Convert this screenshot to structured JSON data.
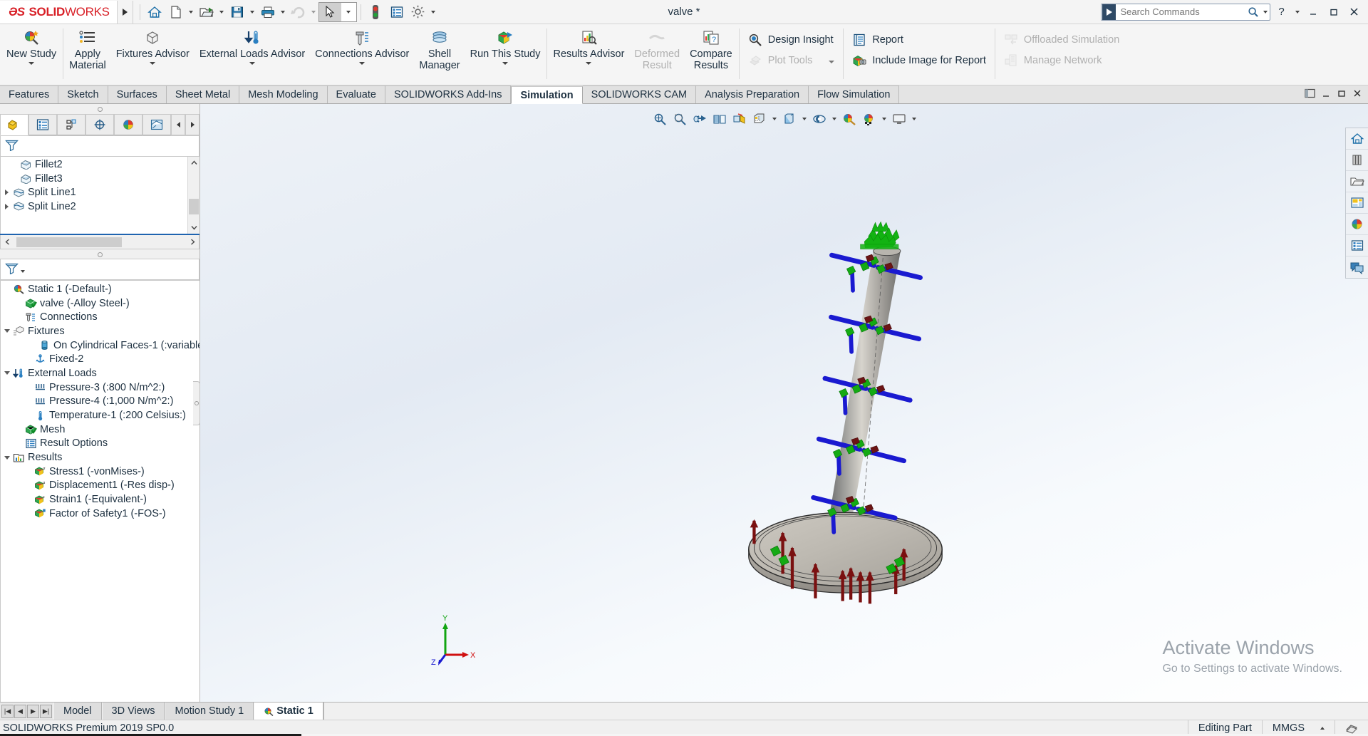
{
  "window": {
    "document_title": "valve *",
    "minimize": "–",
    "maximize": "▭",
    "close": "✕",
    "help": "?",
    "help_caret": "▾"
  },
  "search": {
    "placeholder": "Search Commands",
    "value": ""
  },
  "quick_access": {
    "items": [
      {
        "name": "home-icon",
        "label": "Home"
      },
      {
        "name": "new-document-icon",
        "label": "New"
      },
      {
        "name": "open-folder-icon",
        "label": "Open"
      },
      {
        "name": "save-icon",
        "label": "Save"
      },
      {
        "name": "print-icon",
        "label": "Print"
      },
      {
        "name": "undo-icon",
        "label": "Undo"
      },
      {
        "name": "select-cursor-icon",
        "label": "Select"
      },
      {
        "name": "rebuild-icon",
        "label": "Rebuild"
      },
      {
        "name": "file-properties-icon",
        "label": "File Properties"
      },
      {
        "name": "options-gear-icon",
        "label": "Options"
      }
    ]
  },
  "ribbon": {
    "groups": [
      {
        "name": "study-group",
        "items": [
          {
            "label": "New Study",
            "icon": "new-study-icon",
            "dropdown": true,
            "disabled": false
          }
        ]
      },
      {
        "name": "setup-group",
        "items": [
          {
            "label": "Apply\nMaterial",
            "icon": "apply-material-icon",
            "dropdown": false,
            "disabled": false
          },
          {
            "label": "Fixtures Advisor",
            "icon": "fixtures-advisor-icon",
            "dropdown": true,
            "disabled": false
          },
          {
            "label": "External Loads Advisor",
            "icon": "external-loads-icon",
            "dropdown": true,
            "disabled": false
          },
          {
            "label": "Connections Advisor",
            "icon": "connections-advisor-icon",
            "dropdown": true,
            "disabled": false
          },
          {
            "label": "Shell\nManager",
            "icon": "shell-manager-icon",
            "dropdown": false,
            "disabled": false
          },
          {
            "label": "Run This Study",
            "icon": "run-study-icon",
            "dropdown": true,
            "disabled": false
          }
        ]
      },
      {
        "name": "results-group",
        "items": [
          {
            "label": "Results Advisor",
            "icon": "results-advisor-icon",
            "dropdown": true,
            "disabled": false
          },
          {
            "label": "Deformed\nResult",
            "icon": "deformed-result-icon",
            "dropdown": false,
            "disabled": true
          },
          {
            "label": "Compare\nResults",
            "icon": "compare-results-icon",
            "dropdown": false,
            "disabled": false
          }
        ]
      }
    ],
    "stacks": [
      {
        "name": "insight-stack",
        "rows": [
          {
            "label": "Design Insight",
            "icon": "design-insight-icon",
            "disabled": false,
            "caret": false
          },
          {
            "label": "Plot Tools",
            "icon": "plot-tools-icon",
            "disabled": true,
            "caret": true
          }
        ]
      },
      {
        "name": "report-stack",
        "rows": [
          {
            "label": "Report",
            "icon": "report-icon",
            "disabled": false,
            "caret": false
          },
          {
            "label": "Include Image for Report",
            "icon": "include-image-icon",
            "disabled": false,
            "caret": false
          }
        ]
      },
      {
        "name": "network-stack",
        "rows": [
          {
            "label": "Offloaded Simulation",
            "icon": "offloaded-simulation-icon",
            "disabled": true,
            "caret": false
          },
          {
            "label": "Manage Network",
            "icon": "manage-network-icon",
            "disabled": true,
            "caret": false
          }
        ]
      }
    ]
  },
  "command_tabs": [
    {
      "label": "Features",
      "active": false
    },
    {
      "label": "Sketch",
      "active": false
    },
    {
      "label": "Surfaces",
      "active": false
    },
    {
      "label": "Sheet Metal",
      "active": false
    },
    {
      "label": "Mesh Modeling",
      "active": false
    },
    {
      "label": "Evaluate",
      "active": false
    },
    {
      "label": "SOLIDWORKS Add-Ins",
      "active": false
    },
    {
      "label": "Simulation",
      "active": true
    },
    {
      "label": "SOLIDWORKS CAM",
      "active": false
    },
    {
      "label": "Analysis Preparation",
      "active": false
    },
    {
      "label": "Flow Simulation",
      "active": false
    }
  ],
  "manager_tabs": [
    {
      "name": "feature-manager-tab",
      "icon": "feature-tree-icon",
      "active": true
    },
    {
      "name": "property-manager-tab",
      "icon": "property-manager-icon",
      "active": false
    },
    {
      "name": "configuration-manager-tab",
      "icon": "configuration-manager-icon",
      "active": false
    },
    {
      "name": "dimxpert-manager-tab",
      "icon": "dimxpert-icon",
      "active": false
    },
    {
      "name": "display-manager-tab",
      "icon": "display-manager-icon",
      "active": false
    },
    {
      "name": "simulation-manager-tab",
      "icon": "simulation-study-icon",
      "active": false
    }
  ],
  "feature_tree": {
    "filter_placeholder": "",
    "items": [
      {
        "label": "Fillet2",
        "icon": "fillet-icon",
        "indent": 1,
        "twig": "none"
      },
      {
        "label": "Fillet3",
        "icon": "fillet-icon",
        "indent": 1,
        "twig": "none"
      },
      {
        "label": "Split Line1",
        "icon": "split-line-icon",
        "indent": 1,
        "twig": "closed"
      },
      {
        "label": "Split Line2",
        "icon": "split-line-icon",
        "indent": 1,
        "twig": "closed"
      }
    ]
  },
  "study_tree": {
    "items": [
      {
        "label": "Static 1 (-Default-)",
        "icon": "static-study-icon",
        "indent": 0,
        "twig": "none"
      },
      {
        "label": "valve (-Alloy Steel-)",
        "icon": "part-material-icon",
        "indent": 1,
        "twig": "none"
      },
      {
        "label": "Connections",
        "icon": "connections-icon",
        "indent": 1,
        "twig": "none"
      },
      {
        "label": "Fixtures",
        "icon": "fixtures-icon",
        "indent": 1,
        "twig": "open"
      },
      {
        "label": "On Cylindrical Faces-1 (:variable",
        "icon": "cylindrical-fixture-icon",
        "indent": 2,
        "twig": "none"
      },
      {
        "label": "Fixed-2",
        "icon": "fixed-geometry-icon",
        "indent": 2,
        "twig": "none"
      },
      {
        "label": "External Loads",
        "icon": "external-loads-icon",
        "indent": 1,
        "twig": "open"
      },
      {
        "label": "Pressure-3 (:800 N/m^2:)",
        "icon": "pressure-icon",
        "indent": 2,
        "twig": "none"
      },
      {
        "label": "Pressure-4 (:1,000 N/m^2:)",
        "icon": "pressure-icon",
        "indent": 2,
        "twig": "none"
      },
      {
        "label": "Temperature-1 (:200 Celsius:)",
        "icon": "temperature-icon",
        "indent": 2,
        "twig": "none"
      },
      {
        "label": "Mesh",
        "icon": "mesh-icon",
        "indent": 1,
        "twig": "none"
      },
      {
        "label": "Result Options",
        "icon": "result-options-icon",
        "indent": 1,
        "twig": "none"
      },
      {
        "label": "Results",
        "icon": "results-folder-icon",
        "indent": 1,
        "twig": "open"
      },
      {
        "label": "Stress1 (-vonMises-)",
        "icon": "stress-plot-icon",
        "indent": 2,
        "twig": "none"
      },
      {
        "label": "Displacement1 (-Res disp-)",
        "icon": "displacement-plot-icon",
        "indent": 2,
        "twig": "none"
      },
      {
        "label": "Strain1 (-Equivalent-)",
        "icon": "strain-plot-icon",
        "indent": 2,
        "twig": "none"
      },
      {
        "label": "Factor of Safety1 (-FOS-)",
        "icon": "fos-plot-icon",
        "indent": 2,
        "twig": "none"
      }
    ]
  },
  "viewport_toolbar": [
    {
      "name": "zoom-to-fit-icon",
      "caret": false
    },
    {
      "name": "zoom-to-area-icon",
      "caret": false
    },
    {
      "name": "previous-view-icon",
      "caret": false
    },
    {
      "name": "section-view-icon",
      "caret": false
    },
    {
      "name": "view-orientation-icon",
      "caret": false
    },
    {
      "name": "view-settings-icon",
      "caret": true
    },
    {
      "name": "display-style-icon",
      "caret": true
    },
    {
      "name": "hide-show-items-icon",
      "caret": true
    },
    {
      "name": "edit-appearance-icon",
      "caret": false
    },
    {
      "name": "apply-scene-icon",
      "caret": true
    },
    {
      "name": "view-setting-display-icon",
      "caret": true
    }
  ],
  "right_toolbar": [
    {
      "name": "home-panel-icon"
    },
    {
      "name": "design-library-icon"
    },
    {
      "name": "file-explorer-icon"
    },
    {
      "name": "view-palette-icon"
    },
    {
      "name": "appearances-scenes-icon"
    },
    {
      "name": "custom-properties-icon"
    },
    {
      "name": "solidworks-forum-icon"
    }
  ],
  "triad": {
    "y_label": "Y",
    "x_label": "X",
    "z_label": "Z"
  },
  "watermark": {
    "line1": "Activate Windows",
    "line2": "Go to Settings to activate Windows."
  },
  "bottom_tabs": [
    {
      "label": "Model",
      "active": false,
      "icon": null
    },
    {
      "label": "3D Views",
      "active": false,
      "icon": null
    },
    {
      "label": "Motion Study 1",
      "active": false,
      "icon": null
    },
    {
      "label": "Static 1",
      "active": true,
      "icon": "static-study-icon"
    }
  ],
  "bottom_nav": [
    "|◀",
    "◀",
    "▶",
    "▶|"
  ],
  "status_bar": {
    "version": "SOLIDWORKS Premium 2019 SP0.0",
    "editing": "Editing Part",
    "units": "MMGS",
    "units_caret": "▲"
  }
}
